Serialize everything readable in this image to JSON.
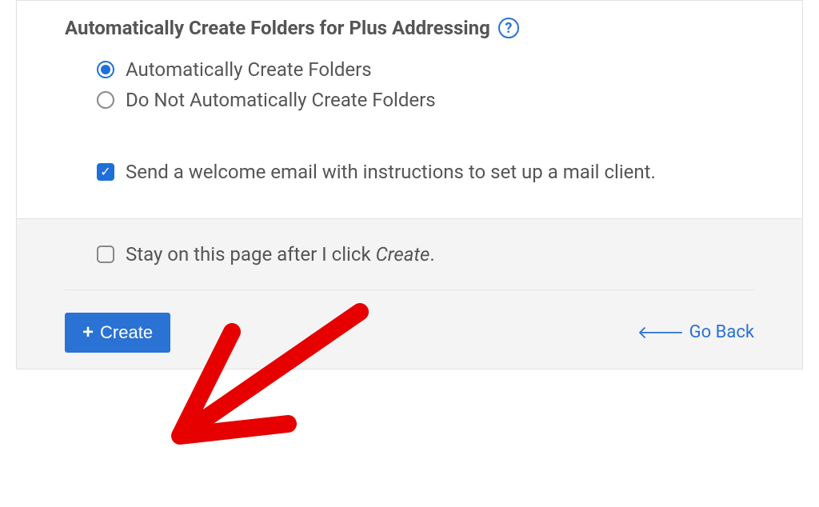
{
  "section": {
    "title": "Automatically Create Folders for Plus Addressing"
  },
  "radios": {
    "option1": "Automatically Create Folders",
    "option2": "Do Not Automatically Create Folders"
  },
  "welcome_checkbox": {
    "label": "Send a welcome email with instructions to set up a mail client."
  },
  "stay_checkbox": {
    "prefix": "Stay on this page after I click ",
    "italic": "Create",
    "suffix": "."
  },
  "buttons": {
    "create": "Create",
    "goback": "Go Back"
  }
}
